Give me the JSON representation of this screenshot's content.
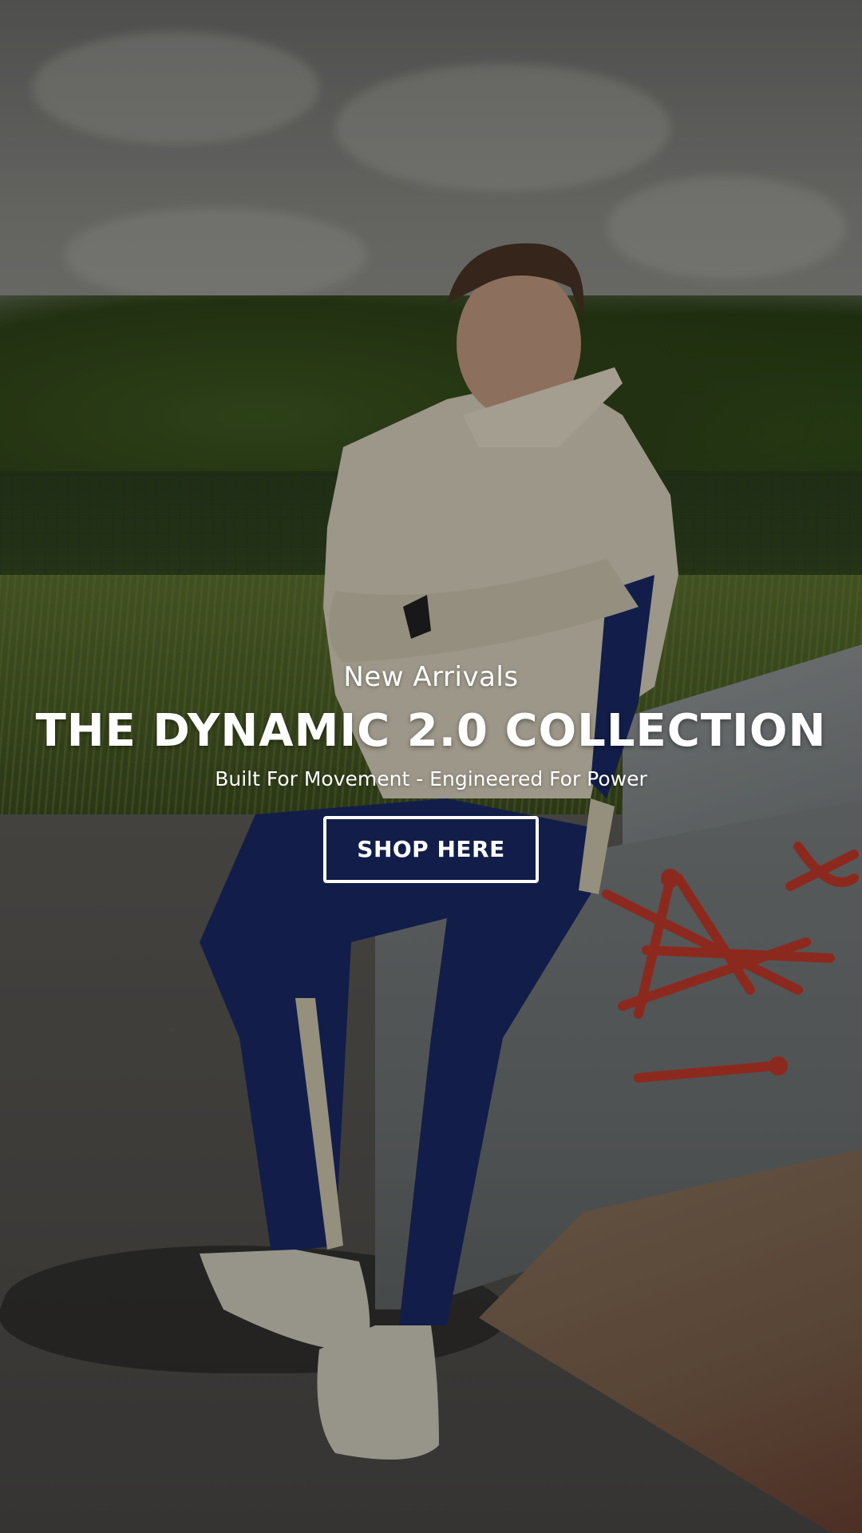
{
  "hero": {
    "eyebrow": "New Arrivals",
    "headline": "THE DYNAMIC 2.0 COLLECTION",
    "tagline": "Built For Movement - Engineered For Power",
    "cta_label": "SHOP HERE"
  },
  "background": {
    "scene": "photo-of-model-in-cream-hoodie-and-navy-joggers-at-skatepark",
    "overlay_color": "#000000",
    "text_color": "#ffffff"
  }
}
